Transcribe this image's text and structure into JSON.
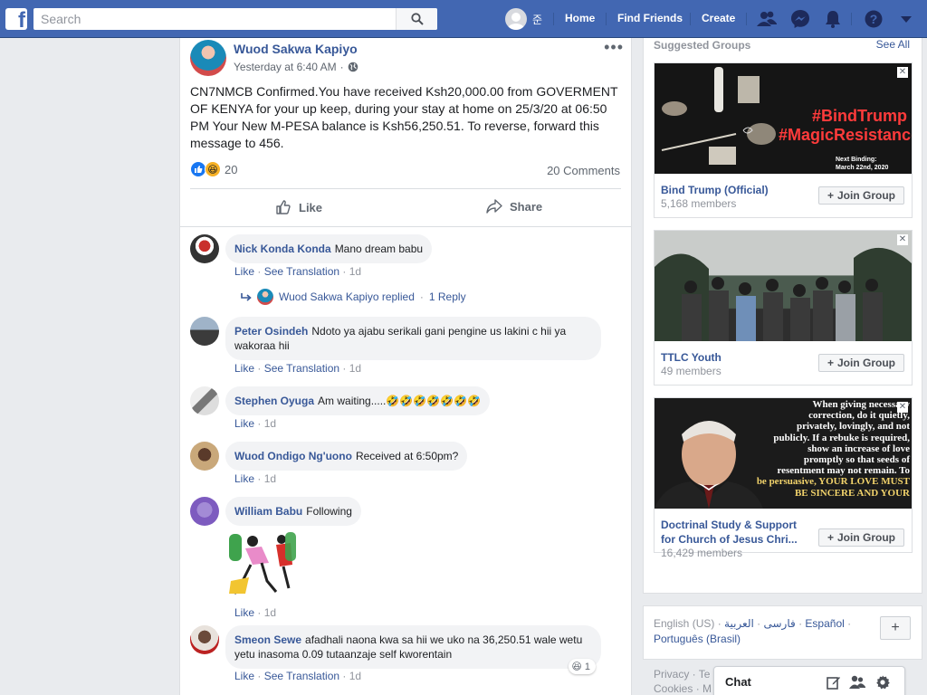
{
  "topbar": {
    "logo": "f",
    "search_placeholder": "Search",
    "user_short_name": "준",
    "nav": [
      "Home",
      "Find Friends",
      "Create"
    ]
  },
  "post": {
    "author": "Wuod Sakwa Kapiyo",
    "timestamp": "Yesterday at 6:40 AM",
    "privacy": "·",
    "text": "CN7NMCB Confirmed.You have received Ksh20,000.00 from GOVERMENT OF KENYA for your up keep, during your stay at home on 25/3/20 at 06:50 PM Your New M-PESA balance is Ksh56,250.51. To reverse, forward this message to 456.",
    "reaction_count": "20",
    "comment_count": "20 Comments",
    "like_label": "Like",
    "share_label": "Share"
  },
  "comments": [
    {
      "name": "Nick Konda Konda",
      "text": "Mano dream babu",
      "actions": {
        "like": "Like",
        "translate": "See Translation",
        "time": "1d"
      }
    },
    {
      "name": "Peter Osindeh",
      "text": "Ndoto ya ajabu serikali gani pengine us lakini c hii ya wakoraa hii",
      "actions": {
        "like": "Like",
        "translate": "See Translation",
        "time": "1d"
      }
    },
    {
      "name": "Stephen Oyuga",
      "text": "Am waiting.....🤣🤣🤣🤣🤣🤣🤣",
      "actions": {
        "like": "Like",
        "time": "1d"
      }
    },
    {
      "name": "Wuod Ondigo Ng'uono",
      "text": "Received at 6:50pm?",
      "actions": {
        "like": "Like",
        "time": "1d"
      }
    },
    {
      "name": "William Babu",
      "text": "Following",
      "actions": {
        "like": "Like",
        "time": "1d"
      }
    },
    {
      "name": "Smeon Sewe",
      "text": "afadhali naona kwa sa hii we uko na 36,250.51 wale wetu yetu inasoma 0.09 tutaanzaje self kworentain",
      "actions": {
        "like": "Like",
        "translate": "See Translation",
        "time": "1d"
      },
      "reaction_count": "1"
    }
  ],
  "reply": {
    "text": "Wuod Sakwa Kapiyo replied",
    "count": "1 Reply"
  },
  "sidebar": {
    "heading": "Suggested Groups",
    "see_all": "See All",
    "join_label": "Join Group",
    "groups": [
      {
        "name": "Bind Trump (Official)",
        "members": "5,168 members",
        "image_text": [
          "#BindTrump",
          "#MagicResistance"
        ],
        "image_caption": [
          "Next Binding:",
          "March 22nd, 2020"
        ]
      },
      {
        "name": "TTLC Youth",
        "members": "49 members"
      },
      {
        "name": "Doctrinal Study & Support for Church of Jesus Chri...",
        "members": "16,429 members",
        "image_text": [
          "When giving necessary",
          "correction, do it quietly,",
          "privately, lovingly, and not",
          "publicly. If a rebuke is required,",
          "show an increase of love",
          "promptly so that seeds of",
          "resentment may not remain. To",
          "be persuasive, YOUR LOVE MUST",
          "BE SINCERE AND YOUR"
        ]
      }
    ]
  },
  "languages": {
    "current": "English (US)",
    "others": [
      "فارسی",
      "العربية",
      "Español"
    ],
    "second_line": "Português (Brasil)",
    "add": "+"
  },
  "footer": {
    "line1": "Privacy · Te",
    "line2": "Cookies · M"
  },
  "chat": {
    "label": "Chat"
  },
  "colors": {
    "brand": "#4267b2",
    "link": "#385898",
    "bg": "#e9ebee"
  }
}
